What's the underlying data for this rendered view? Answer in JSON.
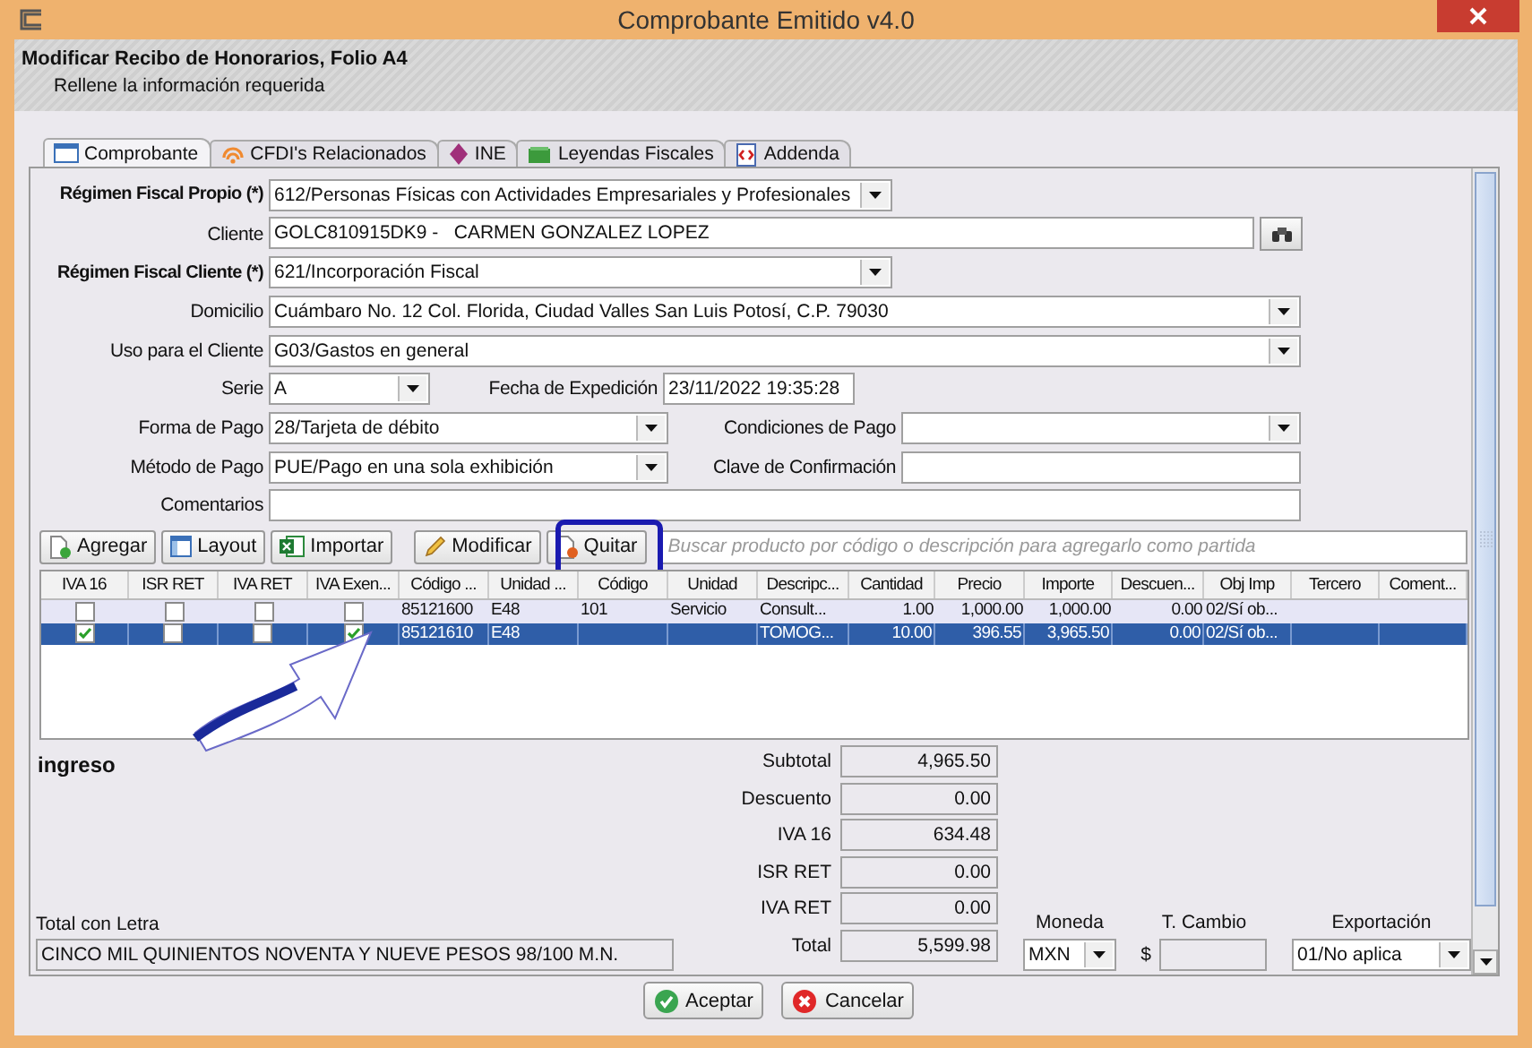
{
  "window": {
    "title": "Comprobante Emitido v4.0"
  },
  "header": {
    "title": "Modificar Recibo de Honorarios, Folio A4",
    "subtitle": "Rellene la información requerida"
  },
  "tabs": [
    {
      "label": "Comprobante",
      "selected": true
    },
    {
      "label": "CFDI's Relacionados",
      "selected": false
    },
    {
      "label": "INE",
      "selected": false
    },
    {
      "label": "Leyendas Fiscales",
      "selected": false
    },
    {
      "label": "Addenda",
      "selected": false
    }
  ],
  "form": {
    "rows": [
      [
        {
          "label": "Régimen Fiscal Propio (*)",
          "required": true,
          "kind": "select",
          "value": "612/Personas Físicas con Actividades Empresariales y Profesionales"
        }
      ],
      [
        {
          "label": "Cliente",
          "required": false,
          "kind": "lookup",
          "value": "GOLC810915DK9 -   CARMEN GONZALEZ LOPEZ"
        }
      ],
      [
        {
          "label": "Régimen Fiscal Cliente (*)",
          "required": true,
          "kind": "select",
          "value": "621/Incorporación Fiscal"
        }
      ],
      [
        {
          "label": "Domicilio",
          "required": false,
          "kind": "select",
          "value": "Cuámbaro No. 12 Col. Florida, Ciudad Valles San Luis Potosí, C.P. 79030"
        }
      ],
      [
        {
          "label": "Uso para el Cliente",
          "required": false,
          "kind": "select",
          "value": "G03/Gastos en general"
        }
      ],
      [
        {
          "label": "Serie",
          "required": false,
          "kind": "select",
          "value": "A"
        },
        {
          "label": "Fecha de Expedición",
          "required": false,
          "kind": "input",
          "value": "23/11/2022 19:35:28"
        }
      ],
      [
        {
          "label": "Forma de Pago",
          "required": false,
          "kind": "select",
          "value": "28/Tarjeta de débito"
        },
        {
          "label": "Condiciones de Pago",
          "required": false,
          "kind": "select"
        }
      ],
      [
        {
          "label": "Método de Pago",
          "required": false,
          "kind": "select",
          "value": "PUE/Pago en una sola exhibición"
        },
        {
          "label": "Clave de Confirmación",
          "required": false,
          "kind": "input"
        }
      ],
      [
        {
          "label": "Comentarios",
          "required": false,
          "kind": "input"
        }
      ]
    ]
  },
  "toolbar": {
    "buttons": [
      "Agregar",
      "Layout",
      "Importar",
      "Modificar",
      "Quitar"
    ],
    "search": {
      "placeholder": "Buscar producto por código o descripción para agregarlo como partida"
    }
  },
  "table": {
    "columns": [
      {
        "label": "IVA 16",
        "kind": "check"
      },
      {
        "label": "ISR RET",
        "kind": "check"
      },
      {
        "label": "IVA RET",
        "kind": "check"
      },
      {
        "label": "IVA Exen...",
        "kind": "check"
      },
      {
        "label": "Código ...",
        "kind": "text"
      },
      {
        "label": "Unidad ...",
        "kind": "text"
      },
      {
        "label": "Código",
        "kind": "text"
      },
      {
        "label": "Unidad",
        "kind": "text"
      },
      {
        "label": "Descripc...",
        "kind": "text"
      },
      {
        "label": "Cantidad",
        "kind": "number"
      },
      {
        "label": "Precio",
        "kind": "number"
      },
      {
        "label": "Importe",
        "kind": "number"
      },
      {
        "label": "Descuen...",
        "kind": "number"
      },
      {
        "label": "Obj Imp",
        "kind": "text"
      },
      {
        "label": "Tercero",
        "kind": "text"
      },
      {
        "label": "Coment...",
        "kind": "text"
      }
    ],
    "rows": [
      {
        "selected": false,
        "cells": [
          {
            "checked": false
          },
          {
            "checked": false
          },
          {
            "checked": false
          },
          {
            "checked": false
          },
          "85121600",
          "E48",
          "101",
          "Servicio",
          "Consult...",
          "1.00",
          "1,000.00",
          "1,000.00",
          "0.00",
          "02/Sí ob...",
          "",
          ""
        ]
      },
      {
        "selected": true,
        "cells": [
          {
            "checked": true
          },
          {
            "checked": false
          },
          {
            "checked": false
          },
          {
            "checked": true
          },
          "85121610",
          "E48",
          "",
          "",
          "TOMOG...",
          "10.00",
          "396.55",
          "3,965.50",
          "0.00",
          "02/Sí ob...",
          "",
          ""
        ]
      }
    ]
  },
  "summary": {
    "type": "ingreso",
    "totals": [
      {
        "label": "Subtotal",
        "value": "4,965.50"
      },
      {
        "label": "Descuento",
        "value": "0.00"
      },
      {
        "label": "IVA 16",
        "value": "634.48"
      },
      {
        "label": "ISR RET",
        "value": "0.00"
      },
      {
        "label": "IVA RET",
        "value": "0.00"
      },
      {
        "label": "Total",
        "value": "5,599.98"
      }
    ],
    "total_in_words": {
      "label": "Total con Letra",
      "value": "CINCO MIL QUINIENTOS NOVENTA Y NUEVE PESOS 98/100 M.N."
    },
    "currency": {
      "label": "Moneda",
      "value": "MXN"
    },
    "exchange_rate": {
      "label": "T. Cambio",
      "prefix": "$"
    },
    "export": {
      "label": "Exportación",
      "value": "01/No aplica"
    }
  },
  "buttons": [
    {
      "label": "Aceptar",
      "kind": "accept"
    },
    {
      "label": "Cancelar",
      "kind": "cancel"
    }
  ]
}
